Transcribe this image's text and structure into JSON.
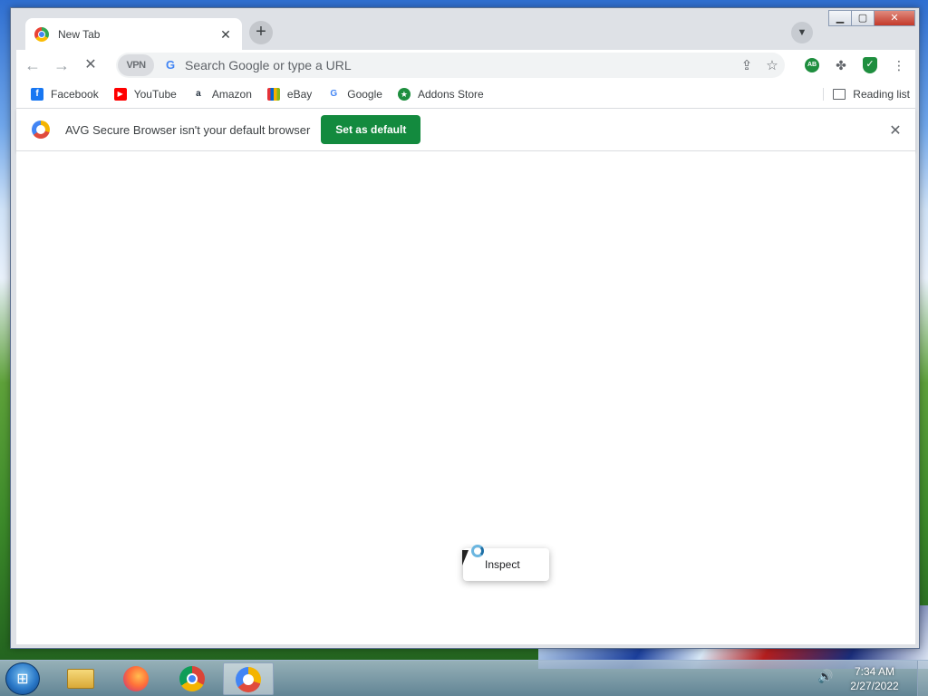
{
  "browser": {
    "tab": {
      "title": "New Tab"
    },
    "omnibox": {
      "vpn_label": "VPN",
      "placeholder": "Search Google or type a URL"
    },
    "bookmarks": [
      {
        "label": "Facebook",
        "icon": "facebook-icon",
        "color": "#1877f2",
        "glyph": "f"
      },
      {
        "label": "YouTube",
        "icon": "youtube-icon",
        "color": "#ff0000",
        "glyph": "▶"
      },
      {
        "label": "Amazon",
        "icon": "amazon-icon",
        "color": "#232f3e",
        "glyph": "a"
      },
      {
        "label": "eBay",
        "icon": "ebay-icon",
        "color": "#e53238",
        "glyph": "e"
      },
      {
        "label": "Google",
        "icon": "google-icon",
        "color": "#4285f4",
        "glyph": "G"
      },
      {
        "label": "Addons Store",
        "icon": "addons-store-icon",
        "color": "#1e8e3e",
        "glyph": "★"
      }
    ],
    "reading_list": "Reading list",
    "infobar": {
      "message": "AVG Secure Browser isn't your default browser",
      "button": "Set as default"
    },
    "context_menu": {
      "item": "Inspect"
    }
  },
  "taskbar": {
    "time": "7:34 AM",
    "date": "2/27/2022"
  },
  "colors": {
    "accent_green": "#138a3e",
    "tab_strip": "#dee1e6"
  }
}
